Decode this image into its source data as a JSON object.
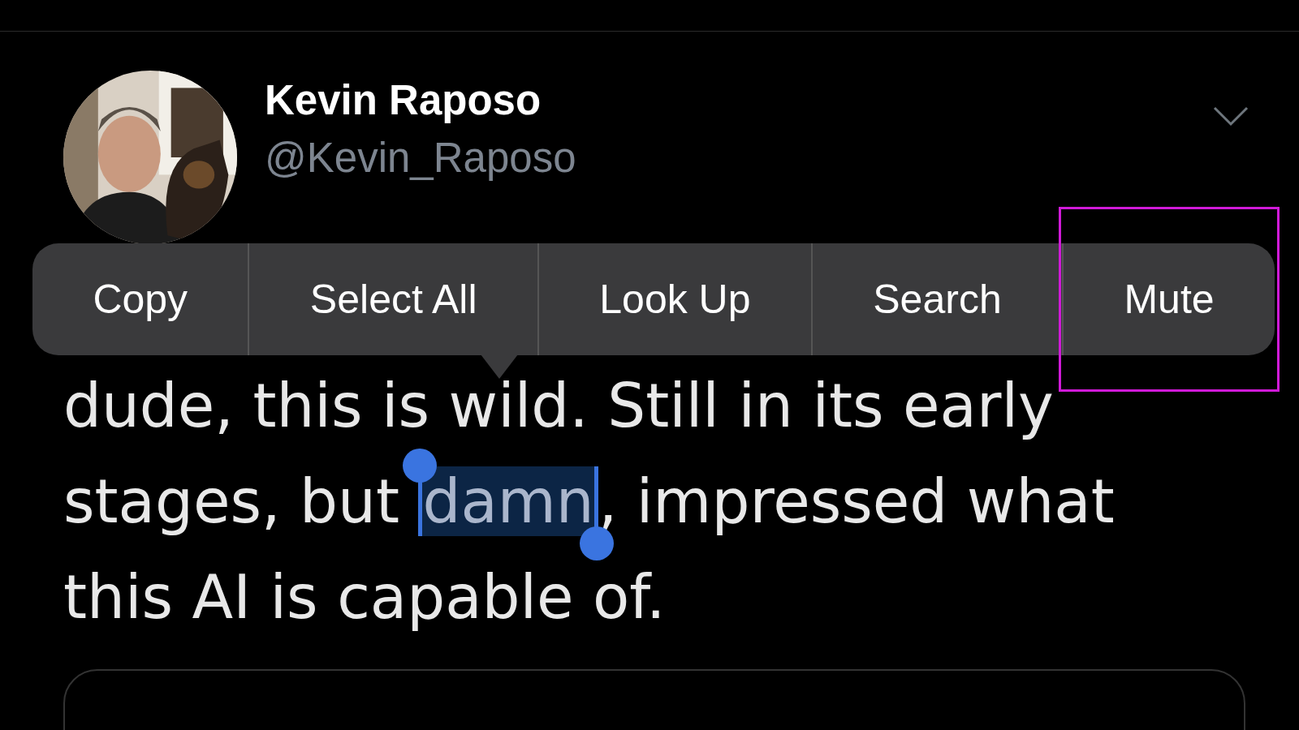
{
  "tweet": {
    "author": "Kevin Raposo",
    "handle": "@Kevin_Raposo",
    "text_before": "dude, this is wild. Still in its early stages, but ",
    "selected_text": "damn",
    "text_after": ", impressed what this AI is capable of."
  },
  "context_menu": {
    "items": [
      {
        "label": "Copy",
        "highlighted": false
      },
      {
        "label": "Select All",
        "highlighted": false
      },
      {
        "label": "Look Up",
        "highlighted": false
      },
      {
        "label": "Search",
        "highlighted": false
      },
      {
        "label": "Mute",
        "highlighted": true
      }
    ]
  }
}
